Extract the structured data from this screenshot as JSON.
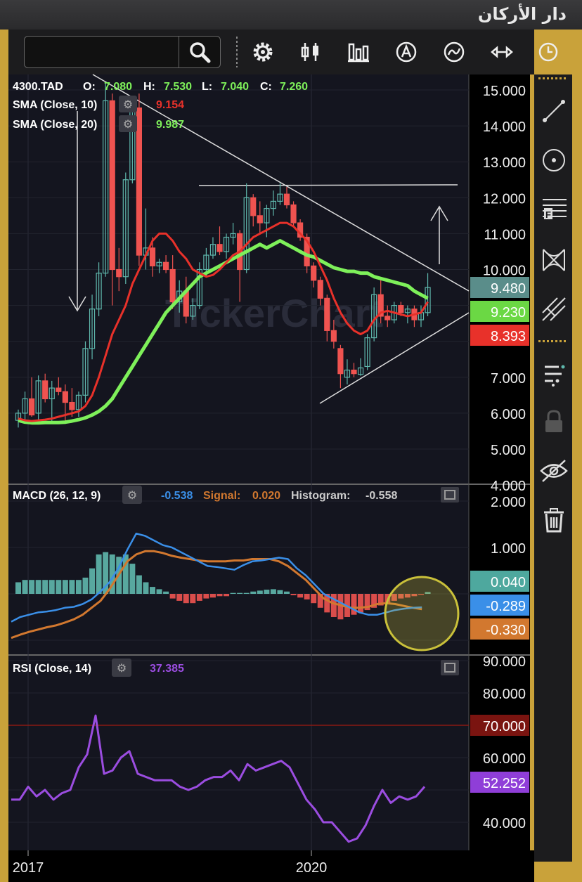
{
  "app": {
    "title": "دار الأركان"
  },
  "search": {
    "value": ""
  },
  "toolbar": {
    "icons": [
      "gear-icon",
      "indicator-icon",
      "bar-chart-icon",
      "annotation-icon",
      "chart-type-icon",
      "compare-icon",
      "clock-icon"
    ]
  },
  "sidebar": {
    "icons": [
      "line-draw-icon",
      "circle-draw-icon",
      "fibonacci-icon",
      "pattern-icon",
      "pitchfork-icon",
      "layers-icon",
      "lock-icon",
      "hide-icon",
      "trash-icon"
    ]
  },
  "legend": {
    "symbol": "4300.TAD",
    "o_label": "O:",
    "o": "7.080",
    "h_label": "H:",
    "h": "7.530",
    "l_label": "L:",
    "l": "7.040",
    "c_label": "C:",
    "c": "7.260",
    "sma10_label": "SMA  (Close, 10)",
    "sma10_value": "9.154",
    "sma20_label": "SMA  (Close, 20)",
    "sma20_value": "9.987"
  },
  "macd_legend": {
    "label": "MACD  (26, 12, 9)",
    "macd": "-0.538",
    "signal_label": "Signal:",
    "signal": "0.020",
    "hist_label": "Histogram:",
    "hist": "-0.558"
  },
  "rsi_legend": {
    "label": "RSI  (Close, 14)",
    "value": "37.385"
  },
  "colors": {
    "bg": "#14151f",
    "up": "#5fb8ad",
    "down": "#ef5350",
    "sma10": "#e8312a",
    "sma20": "#7ef05a",
    "macd": "#3a8fe8",
    "signal": "#d2782f",
    "rsi": "#9b4de0",
    "accent": "#c9a23a"
  },
  "chart_data": [
    {
      "type": "candlestick",
      "title": "4300.TAD",
      "y_ticks": [
        "15.000",
        "14.000",
        "13.000",
        "12.000",
        "11.000",
        "10.000",
        "7.000",
        "6.000",
        "5.000",
        "4.000"
      ],
      "x_ticks": [
        "2017",
        "2020"
      ],
      "ylim": [
        4.0,
        15.5
      ],
      "price_tags": [
        "9.480",
        "9.230",
        "8.393"
      ],
      "candles": [
        {
          "o": 5.8,
          "h": 6.1,
          "l": 5.6,
          "c": 6.0
        },
        {
          "o": 6.0,
          "h": 6.6,
          "l": 5.8,
          "c": 6.4
        },
        {
          "o": 6.4,
          "h": 7.0,
          "l": 5.9,
          "c": 5.95
        },
        {
          "o": 6.0,
          "h": 7.05,
          "l": 5.8,
          "c": 6.9
        },
        {
          "o": 6.9,
          "h": 7.1,
          "l": 6.3,
          "c": 6.4
        },
        {
          "o": 6.4,
          "h": 6.9,
          "l": 5.7,
          "c": 6.7
        },
        {
          "o": 6.7,
          "h": 7.0,
          "l": 6.5,
          "c": 6.6
        },
        {
          "o": 6.6,
          "h": 6.8,
          "l": 5.7,
          "c": 6.3
        },
        {
          "o": 6.3,
          "h": 6.7,
          "l": 5.9,
          "c": 6.1
        },
        {
          "o": 6.1,
          "h": 6.6,
          "l": 5.9,
          "c": 6.5
        },
        {
          "o": 6.5,
          "h": 8.0,
          "l": 6.3,
          "c": 7.8
        },
        {
          "o": 7.8,
          "h": 9.3,
          "l": 7.5,
          "c": 8.9
        },
        {
          "o": 8.9,
          "h": 10.2,
          "l": 8.7,
          "c": 9.9
        },
        {
          "o": 9.9,
          "h": 15.2,
          "l": 9.8,
          "c": 14.7
        },
        {
          "o": 14.7,
          "h": 14.9,
          "l": 9.0,
          "c": 10.0
        },
        {
          "o": 10.0,
          "h": 10.6,
          "l": 9.4,
          "c": 9.8
        },
        {
          "o": 9.8,
          "h": 12.7,
          "l": 9.6,
          "c": 12.5
        },
        {
          "o": 12.5,
          "h": 14.8,
          "l": 12.4,
          "c": 14.5
        },
        {
          "o": 14.5,
          "h": 14.9,
          "l": 10.1,
          "c": 10.4
        },
        {
          "o": 10.4,
          "h": 11.7,
          "l": 10.0,
          "c": 10.6
        },
        {
          "o": 10.6,
          "h": 10.9,
          "l": 9.8,
          "c": 10.1
        },
        {
          "o": 10.1,
          "h": 10.3,
          "l": 9.9,
          "c": 10.2
        },
        {
          "o": 10.2,
          "h": 10.4,
          "l": 9.9,
          "c": 10.0
        },
        {
          "o": 10.0,
          "h": 10.4,
          "l": 8.9,
          "c": 9.1
        },
        {
          "o": 9.1,
          "h": 9.7,
          "l": 8.8,
          "c": 9.4
        },
        {
          "o": 9.4,
          "h": 9.8,
          "l": 8.5,
          "c": 8.7
        },
        {
          "o": 8.7,
          "h": 9.2,
          "l": 8.6,
          "c": 9.0
        },
        {
          "o": 9.0,
          "h": 10.2,
          "l": 8.9,
          "c": 10.0
        },
        {
          "o": 10.0,
          "h": 10.6,
          "l": 9.8,
          "c": 10.4
        },
        {
          "o": 10.4,
          "h": 10.9,
          "l": 10.3,
          "c": 10.7
        },
        {
          "o": 10.7,
          "h": 11.2,
          "l": 10.4,
          "c": 10.5
        },
        {
          "o": 10.5,
          "h": 11.0,
          "l": 10.3,
          "c": 10.9
        },
        {
          "o": 10.9,
          "h": 11.3,
          "l": 10.7,
          "c": 11.0
        },
        {
          "o": 11.0,
          "h": 11.1,
          "l": 9.1,
          "c": 10.0
        },
        {
          "o": 10.0,
          "h": 12.4,
          "l": 9.9,
          "c": 12.0
        },
        {
          "o": 12.0,
          "h": 12.1,
          "l": 11.2,
          "c": 11.5
        },
        {
          "o": 11.5,
          "h": 11.9,
          "l": 11.0,
          "c": 11.3
        },
        {
          "o": 11.3,
          "h": 11.8,
          "l": 10.9,
          "c": 11.7
        },
        {
          "o": 11.7,
          "h": 12.2,
          "l": 11.5,
          "c": 11.9
        },
        {
          "o": 11.9,
          "h": 12.4,
          "l": 11.8,
          "c": 12.1
        },
        {
          "o": 12.1,
          "h": 12.3,
          "l": 11.7,
          "c": 11.8
        },
        {
          "o": 11.8,
          "h": 11.9,
          "l": 11.2,
          "c": 11.3
        },
        {
          "o": 11.3,
          "h": 11.4,
          "l": 10.8,
          "c": 10.9
        },
        {
          "o": 10.9,
          "h": 11.0,
          "l": 9.9,
          "c": 10.1
        },
        {
          "o": 10.1,
          "h": 10.2,
          "l": 9.5,
          "c": 9.7
        },
        {
          "o": 9.7,
          "h": 9.8,
          "l": 9.0,
          "c": 9.2
        },
        {
          "o": 9.2,
          "h": 9.3,
          "l": 8.0,
          "c": 8.3
        },
        {
          "o": 8.3,
          "h": 8.6,
          "l": 7.8,
          "c": 8.0
        },
        {
          "o": 7.8,
          "h": 7.9,
          "l": 6.7,
          "c": 7.1
        },
        {
          "o": 7.0,
          "h": 7.5,
          "l": 6.8,
          "c": 7.2
        },
        {
          "o": 7.2,
          "h": 7.4,
          "l": 7.0,
          "c": 7.1
        },
        {
          "o": 7.08,
          "h": 7.53,
          "l": 7.04,
          "c": 7.26
        },
        {
          "o": 7.3,
          "h": 8.2,
          "l": 7.2,
          "c": 8.1
        },
        {
          "o": 8.1,
          "h": 9.5,
          "l": 8.0,
          "c": 9.3
        },
        {
          "o": 9.3,
          "h": 9.7,
          "l": 8.5,
          "c": 8.7
        },
        {
          "o": 8.7,
          "h": 9.0,
          "l": 8.4,
          "c": 8.6
        },
        {
          "o": 8.6,
          "h": 9.1,
          "l": 8.5,
          "c": 9.0
        },
        {
          "o": 9.0,
          "h": 9.1,
          "l": 8.7,
          "c": 8.8
        },
        {
          "o": 8.8,
          "h": 9.0,
          "l": 8.5,
          "c": 8.9
        },
        {
          "o": 8.9,
          "h": 9.0,
          "l": 8.4,
          "c": 8.6
        },
        {
          "o": 8.6,
          "h": 9.0,
          "l": 8.4,
          "c": 8.8
        },
        {
          "o": 8.8,
          "h": 9.9,
          "l": 8.7,
          "c": 9.5
        }
      ],
      "sma10": [
        5.85,
        5.8,
        5.78,
        5.8,
        5.82,
        5.85,
        5.9,
        5.95,
        6.0,
        6.05,
        6.2,
        6.5,
        7.0,
        7.6,
        8.2,
        8.6,
        9.0,
        9.6,
        10.0,
        10.4,
        10.8,
        11.0,
        11.0,
        10.8,
        10.5,
        10.3,
        10.0,
        9.9,
        9.8,
        9.85,
        10.0,
        10.2,
        10.4,
        10.5,
        10.7,
        10.9,
        11.0,
        11.1,
        11.2,
        11.3,
        11.3,
        11.2,
        11.0,
        10.8,
        10.5,
        10.1,
        9.7,
        9.2,
        8.8,
        8.5,
        8.3,
        8.2,
        8.3,
        8.6,
        8.8,
        8.85,
        8.8,
        8.75,
        8.7,
        8.75,
        8.8,
        9.1
      ],
      "sma20": [
        5.8,
        5.75,
        5.73,
        5.73,
        5.74,
        5.74,
        5.74,
        5.75,
        5.78,
        5.82,
        5.87,
        5.95,
        6.05,
        6.2,
        6.4,
        6.7,
        7.0,
        7.3,
        7.6,
        7.9,
        8.2,
        8.5,
        8.8,
        9.0,
        9.2,
        9.4,
        9.6,
        9.8,
        9.9,
        10.0,
        10.1,
        10.2,
        10.3,
        10.4,
        10.5,
        10.6,
        10.7,
        10.6,
        10.7,
        10.8,
        10.7,
        10.6,
        10.5,
        10.4,
        10.35,
        10.25,
        10.15,
        10.05,
        10.0,
        9.95,
        9.95,
        9.9,
        9.9,
        9.8,
        9.75,
        9.7,
        9.65,
        9.6,
        9.55,
        9.4,
        9.3,
        9.2
      ]
    },
    {
      "type": "line",
      "title": "MACD (26, 12, 9)",
      "y_ticks": [
        "2.000",
        "1.000"
      ],
      "price_tags": [
        "0.040",
        "-0.289",
        "-0.330"
      ],
      "ylim": [
        -1.1,
        2.2
      ],
      "histogram": [
        0.25,
        0.3,
        0.3,
        0.3,
        0.3,
        0.3,
        0.3,
        0.3,
        0.3,
        0.3,
        0.35,
        0.55,
        0.85,
        0.9,
        0.85,
        0.8,
        0.85,
        0.65,
        0.4,
        0.25,
        0.15,
        0.1,
        0.05,
        -0.1,
        -0.15,
        -0.2,
        -0.2,
        -0.15,
        -0.1,
        -0.08,
        -0.05,
        -0.05,
        0.02,
        0.02,
        0.02,
        0.05,
        0.07,
        0.09,
        0.1,
        0.08,
        0.05,
        -0.03,
        -0.08,
        -0.12,
        -0.2,
        -0.3,
        -0.4,
        -0.5,
        -0.55,
        -0.5,
        -0.45,
        -0.4,
        -0.35,
        -0.3,
        -0.25,
        -0.2,
        -0.15,
        -0.1,
        -0.08,
        -0.05,
        -0.02,
        0.04
      ],
      "macd": [
        -0.6,
        -0.5,
        -0.45,
        -0.4,
        -0.38,
        -0.35,
        -0.3,
        -0.28,
        -0.22,
        -0.12,
        0.05,
        0.25,
        0.55,
        0.95,
        1.3,
        1.25,
        1.15,
        1.05,
        1.0,
        0.9,
        0.8,
        0.7,
        0.6,
        0.58,
        0.55,
        0.52,
        0.62,
        0.7,
        0.72,
        0.75,
        0.78,
        0.75,
        0.55,
        0.4,
        0.2,
        0.0,
        -0.1,
        -0.2,
        -0.3,
        -0.4,
        -0.45,
        -0.45,
        -0.4,
        -0.35,
        -0.32,
        -0.3,
        -0.289
      ],
      "signal": [
        -0.95,
        -0.88,
        -0.82,
        -0.77,
        -0.72,
        -0.68,
        -0.62,
        -0.55,
        -0.45,
        -0.3,
        -0.15,
        0.1,
        0.4,
        0.7,
        0.85,
        0.92,
        0.92,
        0.88,
        0.82,
        0.78,
        0.75,
        0.72,
        0.7,
        0.7,
        0.7,
        0.72,
        0.72,
        0.75,
        0.75,
        0.75,
        0.7,
        0.6,
        0.45,
        0.3,
        0.1,
        -0.1,
        -0.2,
        -0.25,
        -0.3,
        -0.3,
        -0.28,
        -0.22,
        -0.2,
        -0.22,
        -0.26,
        -0.3,
        -0.33
      ]
    },
    {
      "type": "line",
      "title": "RSI (Close, 14)",
      "y_ticks": [
        "90.000",
        "80.000",
        "60.000",
        "40.000"
      ],
      "price_tags": [
        "70.000",
        "52.252"
      ],
      "ylim": [
        30,
        91
      ],
      "overbought": 70,
      "values": [
        47,
        47,
        51,
        48,
        50,
        47,
        49,
        50,
        57,
        61,
        73,
        55,
        56,
        60,
        62,
        55,
        54,
        53,
        53,
        53,
        51,
        50,
        51,
        53,
        54,
        54,
        56,
        53,
        58,
        56,
        57,
        58,
        59,
        57,
        52,
        47,
        44,
        40,
        40,
        37,
        34,
        35,
        39,
        45,
        50,
        46,
        48,
        47,
        48,
        51
      ]
    }
  ]
}
